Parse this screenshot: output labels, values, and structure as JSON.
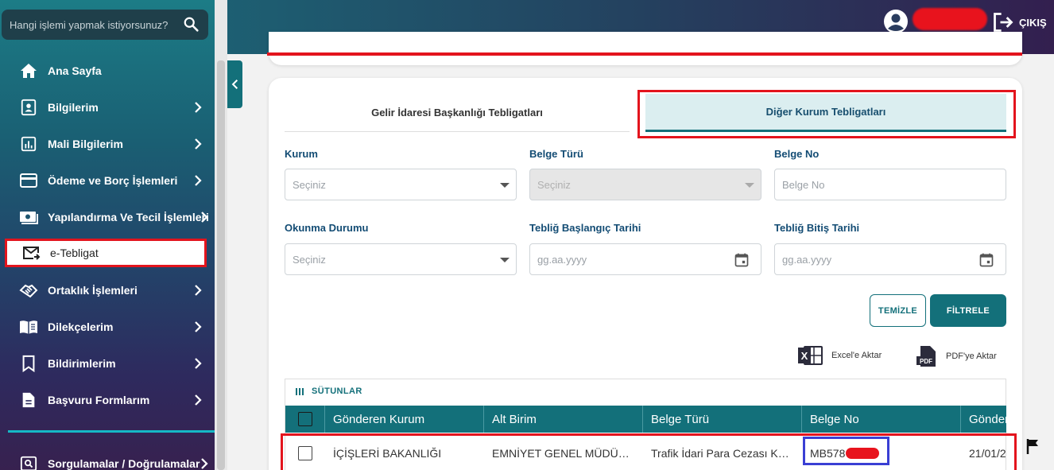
{
  "sidebar": {
    "search_placeholder": "Hangi işlemi yapmak istiyorsunuz?",
    "items": [
      {
        "label": "Ana Sayfa",
        "icon": "home-icon"
      },
      {
        "label": "Bilgilerim",
        "icon": "id-card-icon"
      },
      {
        "label": "Mali Bilgilerim",
        "icon": "bar-chart-icon"
      },
      {
        "label": "Ödeme ve Borç İşlemleri",
        "icon": "credit-card-icon"
      },
      {
        "label": "Yapılandırma Ve Tecil İşlemleri",
        "icon": "money-icon"
      },
      {
        "label": "e-Tebligat",
        "icon": "mail-send-icon"
      },
      {
        "label": "Ortaklık İşlemleri",
        "icon": "handshake-icon"
      },
      {
        "label": "Dilekçelerim",
        "icon": "book-icon"
      },
      {
        "label": "Bildirimlerim",
        "icon": "bookmark-icon"
      },
      {
        "label": "Başvuru Formlarım",
        "icon": "document-icon"
      },
      {
        "label": "Sorgulamalar / Doğrulamalar",
        "icon": "search-box-icon"
      }
    ]
  },
  "header": {
    "logout_label": "ÇIKIŞ"
  },
  "tabs": {
    "gib": "Gelir İdaresi Başkanlığı Tebligatları",
    "other": "Diğer Kurum Tebligatları"
  },
  "filters": {
    "kurum_label": "Kurum",
    "kurum_value": "Seçiniz",
    "belge_turu_label": "Belge Türü",
    "belge_turu_value": "Seçiniz",
    "belge_no_label": "Belge No",
    "belge_no_placeholder": "Belge No",
    "okunma_label": "Okunma Durumu",
    "okunma_value": "Seçiniz",
    "baslangic_label": "Tebliğ Başlangıç Tarihi",
    "baslangic_placeholder": "gg.aa.yyyy",
    "bitis_label": "Tebliğ Bitiş Tarihi",
    "bitis_placeholder": "gg.aa.yyyy"
  },
  "buttons": {
    "clear": "TEMİZLE",
    "filter": "FİLTRELE"
  },
  "export": {
    "excel": "Excel'e Aktar",
    "pdf": "PDF'ye Aktar"
  },
  "table": {
    "columns_label": "SÜTUNLAR",
    "headers": [
      "Gönderen Kurum",
      "Alt Birim",
      "Belge Türü",
      "Belge No",
      "Gönderim"
    ],
    "rows": [
      {
        "gonderen": "İÇİŞLERİ BAKANLIĞI",
        "alt_birim": "EMNİYET GENEL MÜDÜRLÜĞÜ",
        "belge_turu": "Trafik İdari Para Cezası Karar Tutanağı",
        "belge_no": "MB578",
        "tarih": "21/01/2"
      }
    ]
  },
  "colors": {
    "teal": "#13707a",
    "highlight_red": "#e3141d",
    "highlight_blue": "#3a3fd4"
  }
}
